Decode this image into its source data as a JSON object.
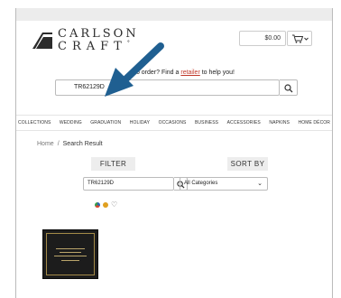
{
  "brand": {
    "line1": "CARLSON",
    "line2": "CRAFT",
    "trademark": "°"
  },
  "cart": {
    "total": "$0.00",
    "cart_icon": "cart-icon",
    "caret_icon": "caret-down-icon"
  },
  "help": {
    "prefix": "to order? Find a ",
    "link": "retailer",
    "suffix": " to help you!"
  },
  "main_search": {
    "value": "TR62129D",
    "icon": "search-icon"
  },
  "nav": {
    "items": [
      "COLLECTIONS",
      "WEDDING",
      "GRADUATION",
      "HOLIDAY",
      "OCCASIONS",
      "BUSINESS",
      "ACCESSORIES",
      "NAPKINS",
      "HOME DÉCOR"
    ]
  },
  "breadcrumb": {
    "home": "Home",
    "separator": "/",
    "current": "Search Result"
  },
  "filter": {
    "label": "FILTER"
  },
  "sort": {
    "label": "SORT BY"
  },
  "filter_search": {
    "value": "TR62129D",
    "icon": "search-icon"
  },
  "category": {
    "selected": "All Categories",
    "icon": "chevron-down-icon"
  },
  "colors": {
    "swatches": [
      "#2a63b0",
      "#e0a020",
      "#c2a04a"
    ],
    "favorite_icon": "heart-icon"
  },
  "annotation": {
    "arrow_color": "#1f5f91"
  },
  "product": {
    "card_color": "#1c1c1c",
    "trim_color": "#a38a48"
  }
}
